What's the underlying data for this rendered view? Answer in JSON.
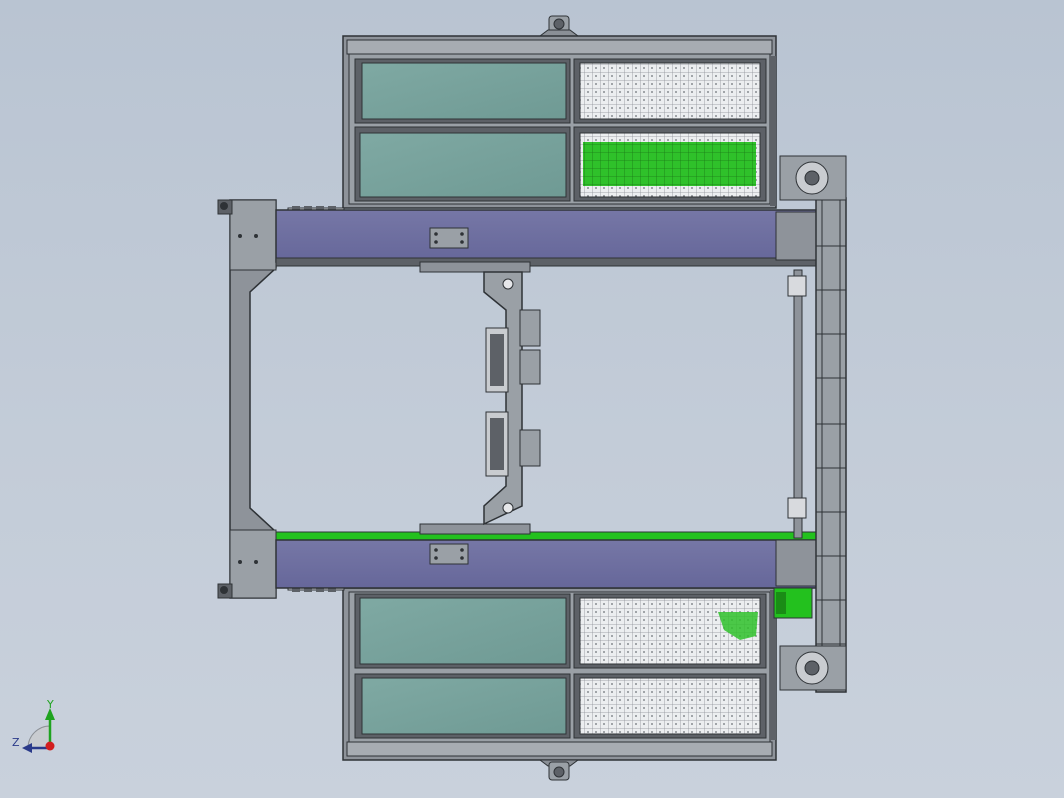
{
  "triad": {
    "y_label": "Y",
    "z_label": "Z"
  },
  "colors": {
    "background": "#c3ccd8",
    "frame": "#8a8f96",
    "outline": "#2e3236",
    "glass": "#7aa59f",
    "beam": "#6e6fa0",
    "highlight_green": "#23c11e",
    "mesh": "#e6e7ea",
    "axis_y": "#1fa31f",
    "axis_z": "#2a3a8a",
    "axis_origin": "#d21e1e"
  },
  "components": {
    "enclosure_top": "top-guard-enclosure",
    "enclosure_bottom": "bottom-guard-enclosure",
    "beam_upper": "upper-conveyor-beam",
    "beam_lower": "lower-conveyor-beam",
    "left_frame": "left-support-frame",
    "carriage": "center-carriage",
    "right_rail": "right-ladder-rail",
    "motor": "green-drive-motor"
  }
}
